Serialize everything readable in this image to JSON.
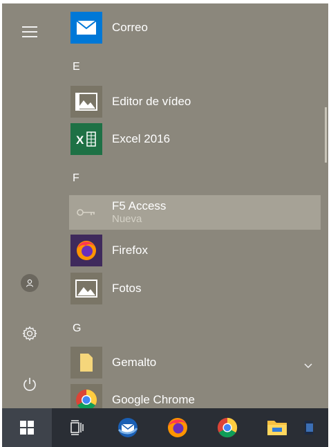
{
  "rail": {
    "menu_icon": "hamburger-icon",
    "user_icon": "user-icon",
    "settings_icon": "gear-icon",
    "power_icon": "power-icon"
  },
  "apps": {
    "correo": {
      "label": "Correo",
      "icon": "mail-icon"
    },
    "section_e": "E",
    "editor": {
      "label": "Editor de vídeo",
      "icon": "video-editor-icon"
    },
    "excel": {
      "label": "Excel 2016",
      "icon": "excel-icon"
    },
    "section_f": "F",
    "f5": {
      "label": "F5 Access",
      "sublabel": "Nueva",
      "icon": "key-icon"
    },
    "firefox": {
      "label": "Firefox",
      "icon": "firefox-icon"
    },
    "fotos": {
      "label": "Fotos",
      "icon": "photos-icon"
    },
    "section_g": "G",
    "gemalto": {
      "label": "Gemalto",
      "icon": "folder-icon",
      "expand_icon": "chevron-down-icon"
    },
    "chrome": {
      "label": "Google Chrome",
      "icon": "chrome-icon"
    }
  },
  "taskbar": {
    "items": [
      "windows-start-icon",
      "task-view-icon",
      "thunderbird-icon",
      "firefox-icon",
      "chrome-icon",
      "file-explorer-icon",
      "app-icon"
    ]
  },
  "colors": {
    "menu_bg": "#8b877c",
    "highlight": "#a6a296",
    "taskbar": "#2a2e35",
    "mail_blue": "#0078d7",
    "excel_green": "#1e7145"
  }
}
